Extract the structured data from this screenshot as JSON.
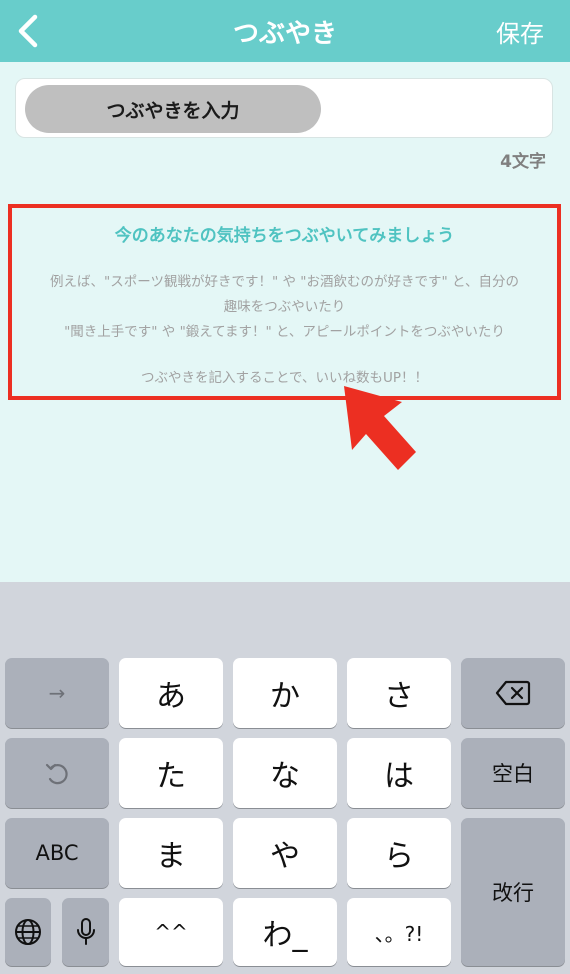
{
  "header": {
    "title": "つぶやき",
    "save_label": "保存"
  },
  "input": {
    "chip_text": "つぶやきを入力"
  },
  "char_count": "4文字",
  "hint": {
    "title": "今のあなたの気持ちをつぶやいてみましょう",
    "lines": [
      "例えば、\"スポーツ観戦が好きです！\" や \"お酒飲むのが好きです\" と、自分の",
      "趣味をつぶやいたり",
      "\"聞き上手です\" や \"鍛えてます！\" と、アピールポイントをつぶやいたり",
      "つぶやきを記入することで、いいね数もUP！！"
    ]
  },
  "keyboard": {
    "row1": [
      "あ",
      "か",
      "さ"
    ],
    "row2": [
      "た",
      "な",
      "は"
    ],
    "row3": [
      "ま",
      "や",
      "ら"
    ],
    "row4": [
      "^^",
      "わ_",
      "、。?!"
    ],
    "space_label": "空白",
    "abc_label": "ABC",
    "enter_label": "改行",
    "next_label": "→"
  }
}
